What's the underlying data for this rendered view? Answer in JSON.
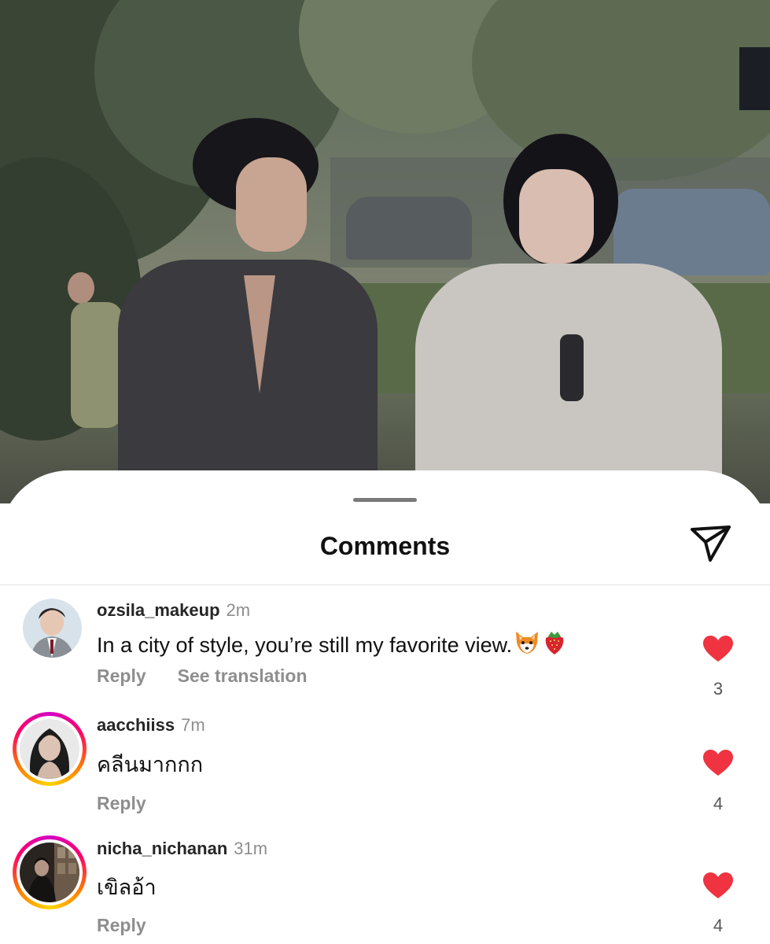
{
  "sheet": {
    "title": "Comments"
  },
  "icons": {
    "share": "paper-plane-icon",
    "like": "heart-icon",
    "grabber": "drag-handle"
  },
  "colors": {
    "like": "#ef3340",
    "muted": "#8e8e8e",
    "story_ring": "#ff0069"
  },
  "comments": [
    {
      "username": "ozsila_makeup",
      "time": "2m",
      "text": "In a city of style, you’re still my favorite view.",
      "emojis": [
        "fox-icon",
        "strawberry-icon"
      ],
      "reply_label": "Reply",
      "translate_label": "See translation",
      "likes": "3",
      "liked": true,
      "story_ring": false
    },
    {
      "username": "aacchiiss",
      "time": "7m",
      "text": "คลีนมากกก",
      "reply_label": "Reply",
      "likes": "4",
      "liked": true,
      "story_ring": true
    },
    {
      "username": "nicha_nichanan",
      "time": "31m",
      "text": "เขิลอ้า",
      "reply_label": "Reply",
      "likes": "4",
      "liked": true,
      "story_ring": true
    }
  ]
}
